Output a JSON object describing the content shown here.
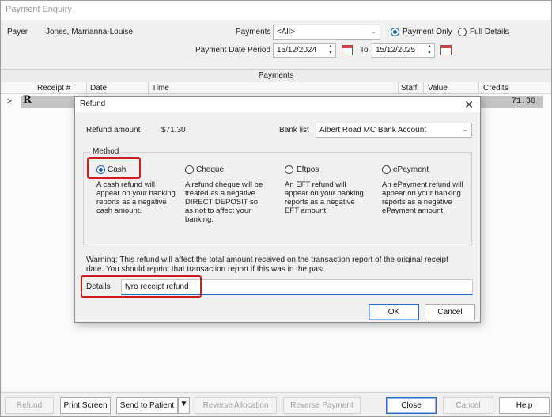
{
  "window": {
    "title": "Payment Enquiry"
  },
  "header": {
    "payer_label": "Payer",
    "payer_name": "Jones, Marrianna-Louise",
    "payments_label": "Payments",
    "payments_filter": "<All>",
    "payment_only_label": "Payment Only",
    "full_details_label": "Full Details",
    "period_label": "Payment Date Period",
    "date_from": "15/12/2024",
    "to_label": "To",
    "date_to": "15/12/2025"
  },
  "grid": {
    "band_title": "Payments",
    "columns": [
      "Receipt #",
      "Date",
      "Time",
      "Staff",
      "Value",
      "Credits"
    ],
    "row_marker": "R",
    "row_expand": ">",
    "row_credits": "71.30"
  },
  "dialog": {
    "title": "Refund",
    "close_glyph": "✕",
    "refund_amount_label": "Refund amount",
    "refund_amount": "$71.30",
    "bank_list_label": "Bank list",
    "bank_account": "Albert Road MC Bank Account",
    "method_legend": "Method",
    "methods": [
      {
        "label": "Cash",
        "desc": "A cash refund will appear on your banking reports as a negative cash amount."
      },
      {
        "label": "Cheque",
        "desc": "A refund cheque will be treated as a negative DIRECT DEPOSIT so as not to affect your banking."
      },
      {
        "label": "Eftpos",
        "desc": "An EFT refund will appear on your banking reports as a negative EFT amount."
      },
      {
        "label": "ePayment",
        "desc": "An ePayment refund will appear on your banking reports as a negative ePayment amount."
      }
    ],
    "warning_line1": "Warning: This refund will affect the total amount received on the transaction report of the original receipt",
    "warning_line2": "date. You should reprint that transaction report if this was in the past.",
    "details_label": "Details",
    "details_value": "tyro receipt refund",
    "ok_label": "OK",
    "cancel_label": "Cancel"
  },
  "bottom_buttons": {
    "refund": "Refund",
    "print_screen": "Print Screen",
    "send_to_patient": "Send to Patient",
    "reverse_allocation": "Reverse Allocation",
    "reverse_payment": "Reverse Payment",
    "close": "Close",
    "cancel": "Cancel",
    "help": "Help"
  },
  "colors": {
    "highlight_box": "#d01c1c",
    "accent": "#2a6cc7"
  }
}
